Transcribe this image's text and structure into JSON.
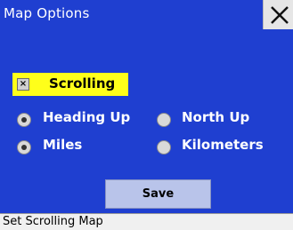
{
  "window": {
    "title": "Map Options"
  },
  "options": {
    "scrolling": {
      "label": "Scrolling",
      "checked": true,
      "mark": "×"
    },
    "orientation": [
      {
        "label": "Heading Up",
        "selected": true
      },
      {
        "label": "North Up",
        "selected": false
      }
    ],
    "units": [
      {
        "label": "Miles",
        "selected": true
      },
      {
        "label": "Kilometers",
        "selected": false
      }
    ]
  },
  "buttons": {
    "save_label": "Save"
  },
  "status": {
    "text": "Set Scrolling Map"
  },
  "colors": {
    "panel": "#1f3fd0",
    "highlight": "#ffff1a",
    "button": "#b9c4ea",
    "status_bg": "#f0f0f0"
  }
}
